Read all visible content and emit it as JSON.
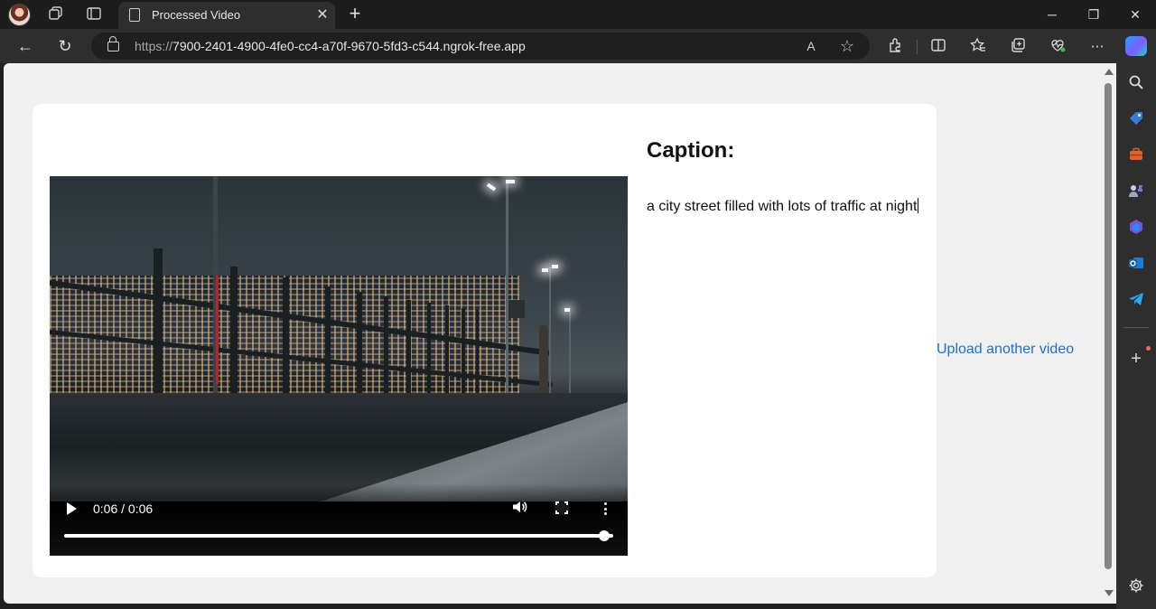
{
  "browser": {
    "tab_title": "Processed Video",
    "url_protocol": "https://",
    "url_host": "7900-2401-4900-4fe0-cc4-a70f-9670-5fd3-c544.ngrok-free.app",
    "icons": {
      "profile": "profile-avatar",
      "workspaces": "workspaces-icon",
      "tab_actions": "tab-actions-icon",
      "new_tab": "+",
      "minimize": "─",
      "restore": "❐",
      "close": "✕",
      "back": "←",
      "refresh": "↻",
      "read_aloud": "A",
      "favorite": "☆",
      "extensions": "extensions-icon",
      "split_screen": "split-screen-icon",
      "favorites": "favorites-icon",
      "collections": "collections-icon",
      "performance": "performance-icon",
      "more": "⋯"
    }
  },
  "page": {
    "caption_heading": "Caption:",
    "caption_text": "a city street filled with lots of traffic at night",
    "upload_link": "Upload another video",
    "link_color": "#1a73c7"
  },
  "video_player": {
    "time_display": "0:06 / 0:06",
    "progress": 1.0
  },
  "sidebar": {
    "items": [
      "search-icon",
      "shopping-tag-icon",
      "tools-icon",
      "games-icon",
      "office-icon",
      "outlook-icon",
      "telegram-icon",
      "add-icon",
      "settings-icon"
    ]
  }
}
